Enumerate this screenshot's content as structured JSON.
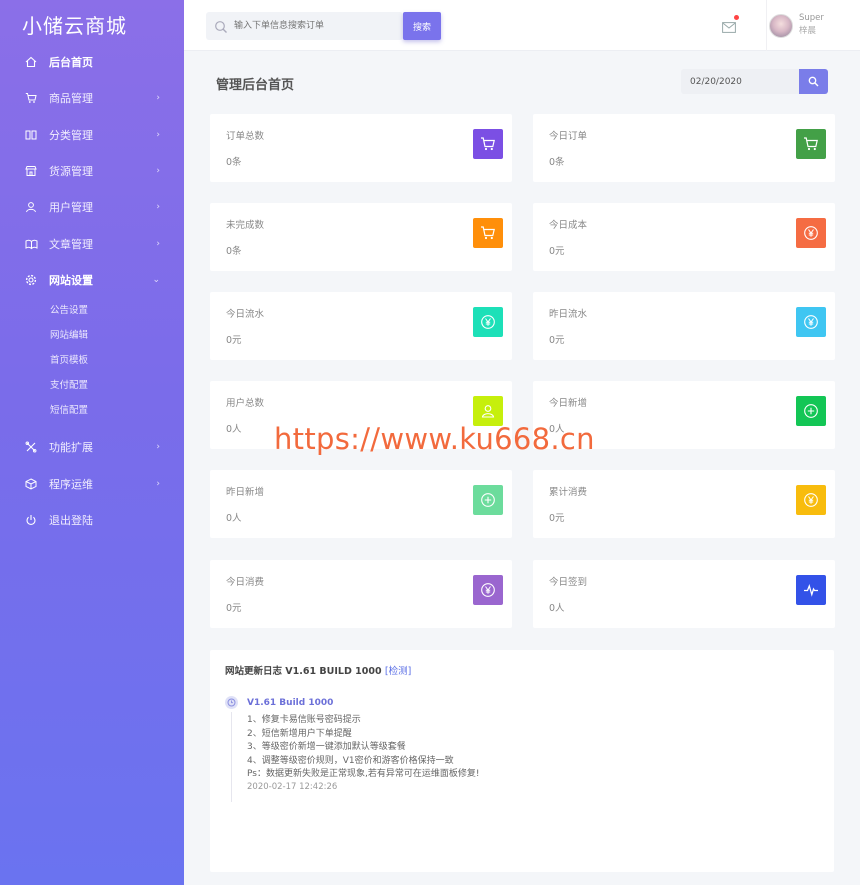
{
  "brand": "小储云商城",
  "sidebar": {
    "items": [
      {
        "label": "后台首页",
        "icon": "home-icon",
        "has_chevron": false,
        "chevron": ""
      },
      {
        "label": "商品管理",
        "icon": "cart-icon",
        "has_chevron": true,
        "chevron": "›"
      },
      {
        "label": "分类管理",
        "icon": "columns-icon",
        "has_chevron": true,
        "chevron": "›"
      },
      {
        "label": "货源管理",
        "icon": "store-icon",
        "has_chevron": true,
        "chevron": "›"
      },
      {
        "label": "用户管理",
        "icon": "user-icon",
        "has_chevron": true,
        "chevron": "›"
      },
      {
        "label": "文章管理",
        "icon": "book-icon",
        "has_chevron": true,
        "chevron": "›"
      },
      {
        "label": "网站设置",
        "icon": "gear-icon",
        "has_chevron": true,
        "chevron": "⌄",
        "expanded": true
      }
    ],
    "subitems": [
      "公告设置",
      "网站编辑",
      "首页模板",
      "支付配置",
      "短信配置"
    ],
    "items_after": [
      {
        "label": "功能扩展",
        "icon": "tools-icon",
        "chevron": "›"
      },
      {
        "label": "程序运维",
        "icon": "cube-icon",
        "chevron": "›"
      },
      {
        "label": "退出登陆",
        "icon": "power-icon",
        "chevron": ""
      }
    ]
  },
  "topbar": {
    "search_placeholder": "输入下单信息搜索订单",
    "search_button": "搜索",
    "user_name": "Super",
    "user_sub": "梓晨"
  },
  "main": {
    "title": "管理后台首页",
    "date_value": "02/20/2020"
  },
  "cards": [
    {
      "label": "订单总数",
      "value": "0条",
      "icon": "cart-icon",
      "color": "#7b4fe4"
    },
    {
      "label": "今日订单",
      "value": "0条",
      "icon": "cart-icon",
      "color": "#43a047"
    },
    {
      "label": "未完成数",
      "value": "0条",
      "icon": "cart-icon",
      "color": "#ff8f0a"
    },
    {
      "label": "今日成本",
      "value": "0元",
      "icon": "yen-icon",
      "color": "#f56c43"
    },
    {
      "label": "今日流水",
      "value": "0元",
      "icon": "yen-icon",
      "color": "#1de0b8"
    },
    {
      "label": "昨日流水",
      "value": "0元",
      "icon": "yen-icon",
      "color": "#3fc6f2"
    },
    {
      "label": "用户总数",
      "value": "0人",
      "icon": "user-icon",
      "color": "#c6ef0c"
    },
    {
      "label": "今日新增",
      "value": "0人",
      "icon": "plus-circle-icon",
      "color": "#13c655"
    },
    {
      "label": "昨日新增",
      "value": "0人",
      "icon": "plus-circle-icon",
      "color": "#6cdc9c"
    },
    {
      "label": "累计消费",
      "value": "0元",
      "icon": "yen-icon",
      "color": "#f8bc0d"
    },
    {
      "label": "今日消费",
      "value": "0元",
      "icon": "yen-icon",
      "color": "#9a66cf"
    },
    {
      "label": "今日签到",
      "value": "0人",
      "icon": "pulse-icon",
      "color": "#3352e8"
    }
  ],
  "log": {
    "title": "网站更新日志 V1.61 BUILD 1000",
    "check_link": "[检测]",
    "version": "V1.61 Build 1000",
    "items": [
      "1、修复卡易信账号密码提示",
      "2、短信新增用户下单提醒",
      "3、等级密价新增一键添加默认等级套餐",
      "4、调整等级密价规则，V1密价和游客价格保持一致",
      "Ps：数据更新失败是正常现象,若有异常可在运维面板修复!"
    ],
    "time": "2020-02-17 12:42:26"
  },
  "watermark": "https://www.ku668.cn"
}
